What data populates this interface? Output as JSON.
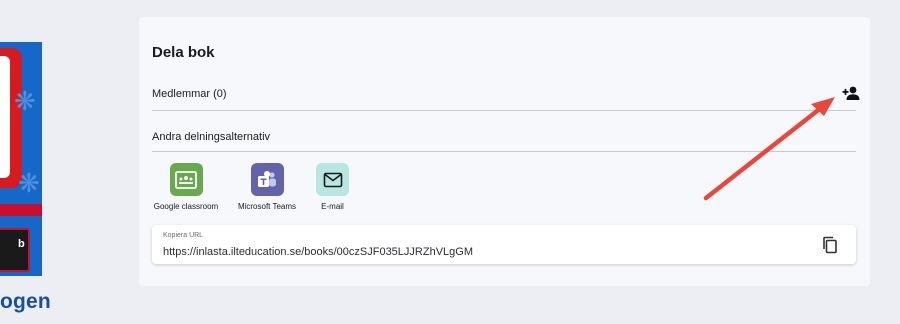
{
  "cover": {
    "title_fragment": "ogen",
    "inner_label": "b",
    "colors": {
      "background": "#1668c8",
      "frame": "#d71920",
      "title": "#1a4ea0"
    }
  },
  "share": {
    "title": "Dela bok",
    "members_label": "Medlemmar (0)",
    "add_member_icon": "person-add-icon",
    "other_options_label": "Andra delningsalternativ",
    "options": [
      {
        "label": "Google classroom",
        "icon": "google-classroom-icon",
        "color": "#6aa84f"
      },
      {
        "label": "Microsoft Teams",
        "icon": "microsoft-teams-icon",
        "color": "#6264a7"
      },
      {
        "label": "E-mail",
        "icon": "email-icon",
        "color": "#b9e6e0"
      }
    ],
    "url": {
      "caption": "Kopiera URL",
      "value": "https://inlasta.ilteducation.se/books/00czSJF035LJJRZhVLgGM",
      "copy_icon": "copy-icon"
    }
  },
  "annotation": {
    "arrow_color": "#e8473c"
  }
}
